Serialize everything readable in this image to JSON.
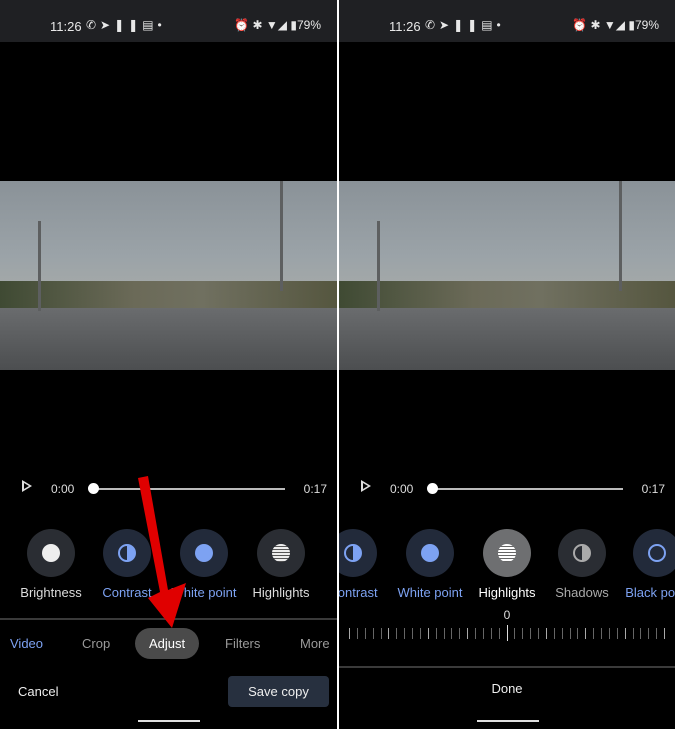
{
  "status": {
    "time": "11:26",
    "notif_icons": [
      "whatsapp-icon",
      "telegram-icon",
      "pause-icon",
      "message-icon",
      "dot-icon"
    ],
    "battery": "79%"
  },
  "player": {
    "current": "0:00",
    "duration": "0:17",
    "progress": 0
  },
  "left": {
    "tools": [
      {
        "label": "Brightness",
        "icon": "brightness-icon"
      },
      {
        "label": "Contrast",
        "icon": "contrast-icon"
      },
      {
        "label": "White point",
        "icon": "white-point-icon"
      },
      {
        "label": "Highlights",
        "icon": "highlights-icon"
      }
    ],
    "tabs": [
      "Video",
      "Crop",
      "Adjust",
      "Filters",
      "More"
    ],
    "active_tab": "Adjust",
    "cancel": "Cancel",
    "save": "Save copy"
  },
  "right": {
    "tools": [
      {
        "label": "Contrast",
        "icon": "contrast-icon"
      },
      {
        "label": "White point",
        "icon": "white-point-icon"
      },
      {
        "label": "Highlights",
        "icon": "highlights-icon"
      },
      {
        "label": "Shadows",
        "icon": "shadows-icon"
      },
      {
        "label": "Black point",
        "icon": "black-point-icon"
      }
    ],
    "selected_tool": "Highlights",
    "slider_value": "0",
    "done": "Done"
  },
  "colors": {
    "accent": "#7da2f2",
    "arrow": "#e00000"
  }
}
